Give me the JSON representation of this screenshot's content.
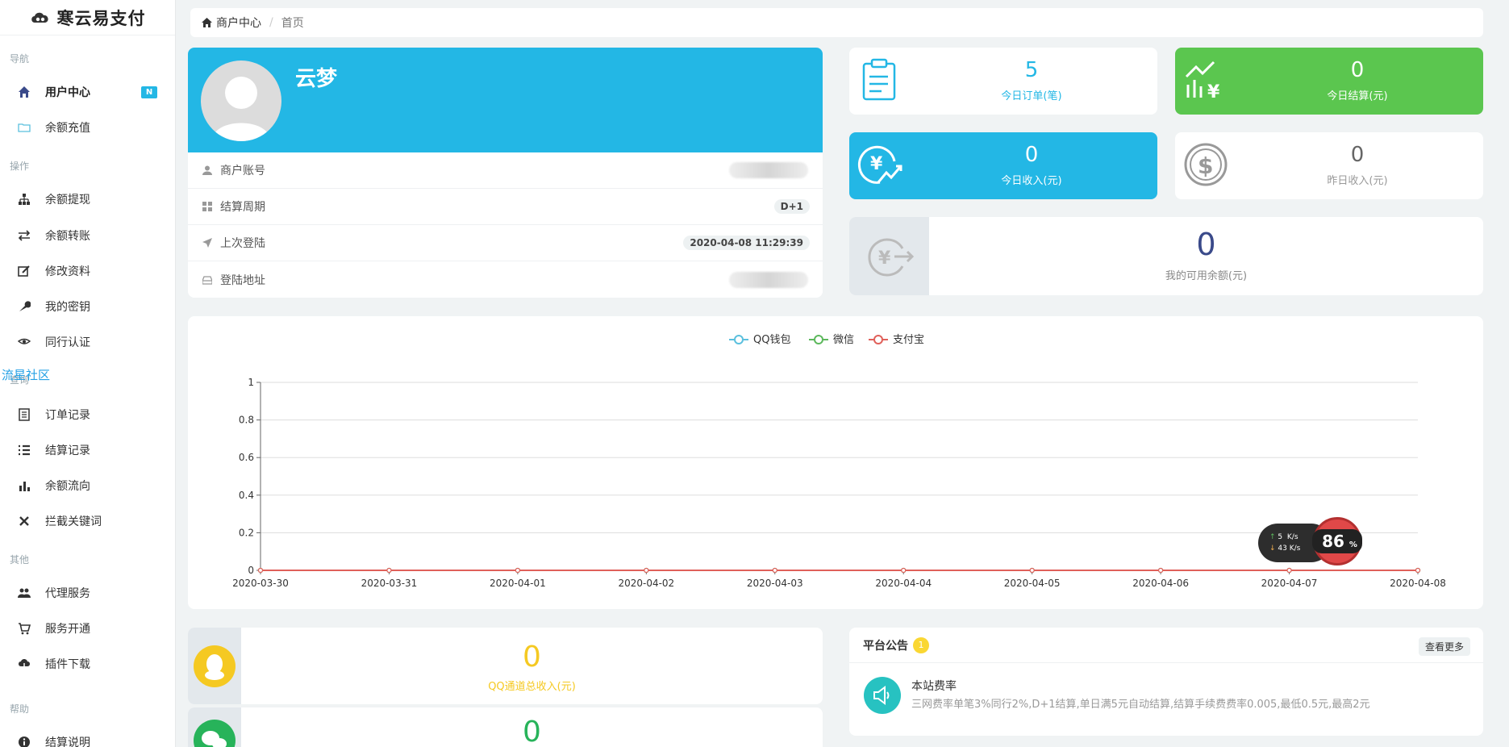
{
  "brand": {
    "name": "寒云易支付"
  },
  "sidebar": {
    "sections": [
      "导航",
      "操作",
      "查询",
      "其他",
      "帮助"
    ],
    "items": [
      {
        "label": "用户中心",
        "icon": "home-icon",
        "badge": "N",
        "active": true
      },
      {
        "label": "余额充值",
        "icon": "folder-icon"
      },
      {
        "label": "余额提现",
        "icon": "sitemap-icon"
      },
      {
        "label": "余额转账",
        "icon": "exchange-icon"
      },
      {
        "label": "修改资料",
        "icon": "edit-icon"
      },
      {
        "label": "我的密钥",
        "icon": "wrench-icon"
      },
      {
        "label": "同行认证",
        "icon": "handshake-icon"
      },
      {
        "label": "订单记录",
        "icon": "list-alt-icon"
      },
      {
        "label": "结算记录",
        "icon": "list-icon"
      },
      {
        "label": "余额流向",
        "icon": "bar-chart-icon"
      },
      {
        "label": "拦截关键词",
        "icon": "close-icon"
      },
      {
        "label": "代理服务",
        "icon": "users-icon"
      },
      {
        "label": "服务开通",
        "icon": "cart-icon"
      },
      {
        "label": "插件下载",
        "icon": "cloud-download-icon"
      },
      {
        "label": "结算说明",
        "icon": "info-icon"
      }
    ],
    "overlay_link": "流星社区"
  },
  "breadcrumb": {
    "home": "商户中心",
    "current": "首页"
  },
  "profile": {
    "name": "云梦",
    "rows": [
      {
        "label": "商户账号",
        "icon": "user-icon",
        "value": ""
      },
      {
        "label": "结算周期",
        "icon": "grid-icon",
        "value": "D+1"
      },
      {
        "label": "上次登陆",
        "icon": "rocket-icon",
        "value": "2020-04-08 11:29:39"
      },
      {
        "label": "登陆地址",
        "icon": "hdd-icon",
        "value": ""
      }
    ]
  },
  "stats": {
    "today_orders": {
      "value": "5",
      "label": "今日订单(笔)"
    },
    "today_settle": {
      "value": "0",
      "label": "今日结算(元)"
    },
    "today_income": {
      "value": "0",
      "label": "今日收入(元)"
    },
    "yesterday_income": {
      "value": "0",
      "label": "昨日收入(元)"
    },
    "balance": {
      "value": "0",
      "label": "我的可用余额(元)"
    }
  },
  "colors": {
    "primary": "#23b7e5",
    "success": "#5bc64f",
    "qq_yellow": "#f5c922",
    "wechat_green": "#27b35a",
    "alipay_red": "#e0605a",
    "qq_series": "#5bc0de",
    "wx_series": "#5cb85c"
  },
  "chart_data": {
    "type": "line",
    "x": [
      "2020-03-30",
      "2020-03-31",
      "2020-04-01",
      "2020-04-02",
      "2020-04-03",
      "2020-04-04",
      "2020-04-05",
      "2020-04-06",
      "2020-04-07",
      "2020-04-08"
    ],
    "series": [
      {
        "name": "QQ钱包",
        "values": [
          0,
          0,
          0,
          0,
          0,
          0,
          0,
          0,
          0,
          0
        ]
      },
      {
        "name": "微信",
        "values": [
          0,
          0,
          0,
          0,
          0,
          0,
          0,
          0,
          0,
          0
        ]
      },
      {
        "name": "支付宝",
        "values": [
          0,
          0,
          0,
          0,
          0,
          0,
          0,
          0,
          0,
          0
        ]
      }
    ],
    "yticks": [
      "0",
      "0.2",
      "0.4",
      "0.6",
      "0.8",
      "1"
    ],
    "ylim": [
      0,
      1
    ],
    "legend": "top-center",
    "grid": true
  },
  "channels": {
    "qq": {
      "value": "0",
      "label": "QQ通道总收入(元)"
    },
    "wechat": {
      "value": "0"
    }
  },
  "notice": {
    "title": "平台公告",
    "count": "1",
    "more": "查看更多",
    "item_title": "本站费率",
    "item_text": "三网费率单笔3%同行2%,D+1结算,单日满5元自动结算,结算手续费费率0.005,最低0.5元,最高2元"
  },
  "speed_widget": {
    "up": "5",
    "down": "43",
    "unit": "K/s",
    "percent": "86",
    "percent_sign": "%"
  }
}
